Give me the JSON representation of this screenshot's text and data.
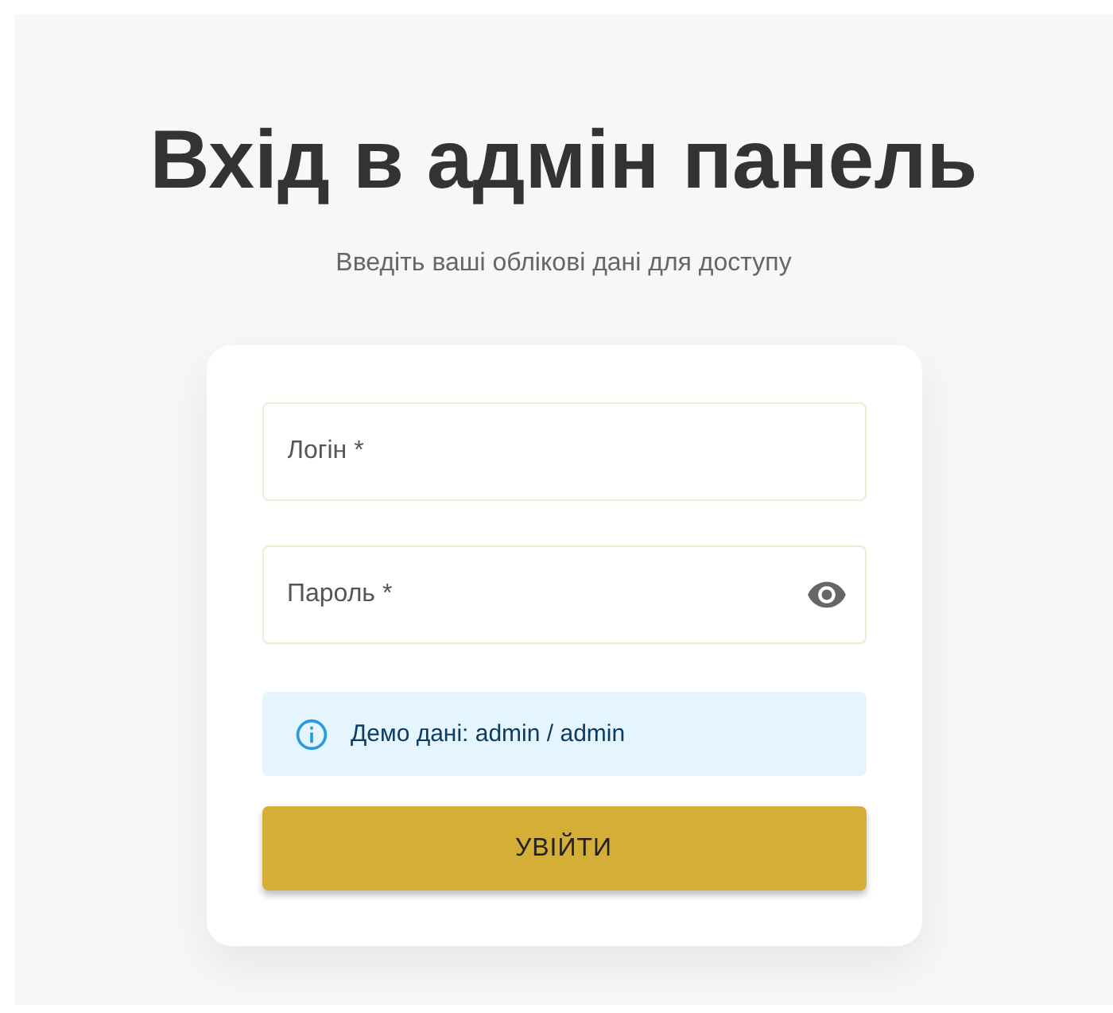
{
  "title": "Вхід в адмін панель",
  "subtitle": "Введіть ваші облікові дані для доступу",
  "fields": [
    {
      "kind": "text",
      "placeholder": "Логін *"
    },
    {
      "kind": "password",
      "placeholder": "Пароль *"
    }
  ],
  "info": "Демо дані: admin / admin",
  "button": "УВІЙТИ"
}
